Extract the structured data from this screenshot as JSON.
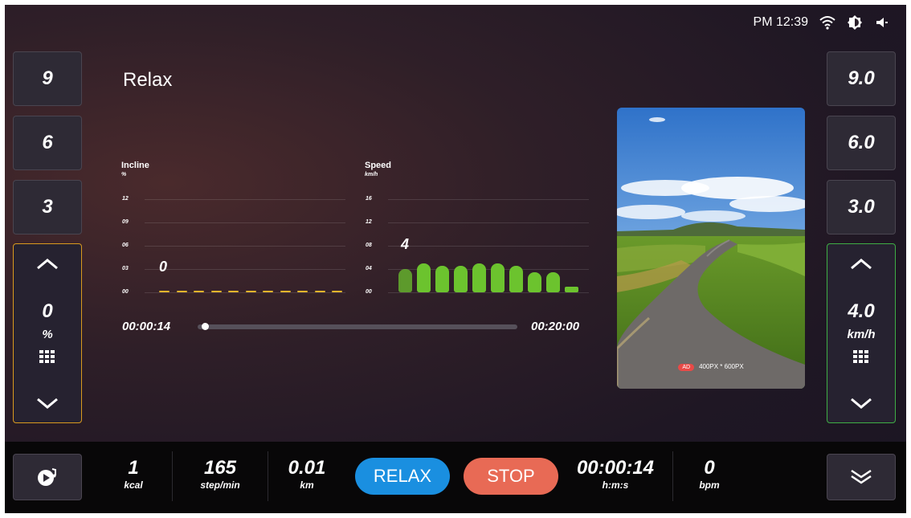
{
  "status_bar": {
    "time": "PM 12:39",
    "icons": [
      "wifi-icon",
      "brightness-icon",
      "volume-icon"
    ]
  },
  "left_panel": {
    "presets": [
      "9",
      "6",
      "3"
    ],
    "incline": {
      "value": "0",
      "unit": "%",
      "icons": [
        "chevron-up-icon",
        "keypad-icon",
        "chevron-down-icon"
      ]
    },
    "accent": "#d99a1e"
  },
  "right_panel": {
    "presets": [
      "9.0",
      "6.0",
      "3.0"
    ],
    "speed": {
      "value": "4.0",
      "unit": "km/h",
      "icons": [
        "chevron-up-icon",
        "keypad-icon",
        "chevron-down-icon"
      ]
    },
    "accent": "#3fae45"
  },
  "program": {
    "title": "Relax"
  },
  "incline_chart": {
    "label": "Incline",
    "unit": "%",
    "ticks": [
      "12",
      "09",
      "06",
      "03",
      "00"
    ],
    "current_value": "0",
    "values": [
      0,
      0,
      0,
      0,
      0,
      0,
      0,
      0,
      0,
      0,
      0
    ],
    "color": "#e2b42b"
  },
  "speed_chart": {
    "label": "Speed",
    "unit": "km/h",
    "ticks": [
      "16",
      "12",
      "08",
      "04",
      "00"
    ],
    "current_value": "4",
    "values": [
      4,
      5,
      4.5,
      4.5,
      5,
      5,
      4.5,
      3.5,
      3.5,
      1
    ],
    "color": "#6cc32e"
  },
  "progress": {
    "elapsed": "00:00:14",
    "total": "00:20:00",
    "fraction": 0.012
  },
  "ad": {
    "badge": "AD",
    "text": "400PX * 600PX"
  },
  "bottom_bar": {
    "stats": [
      {
        "value": "1",
        "unit": "kcal"
      },
      {
        "value": "165",
        "unit": "step/min"
      },
      {
        "value": "0.01",
        "unit": "km"
      },
      {
        "value": "00:00:14",
        "unit": "h:m:s"
      },
      {
        "value": "0",
        "unit": "bpm"
      }
    ],
    "relax_label": "RELAX",
    "stop_label": "STOP",
    "relax_color": "#1a8fe0",
    "stop_color": "#e86a55",
    "left_icon": "music-disc-icon",
    "right_icon": "double-chevron-down-icon"
  }
}
